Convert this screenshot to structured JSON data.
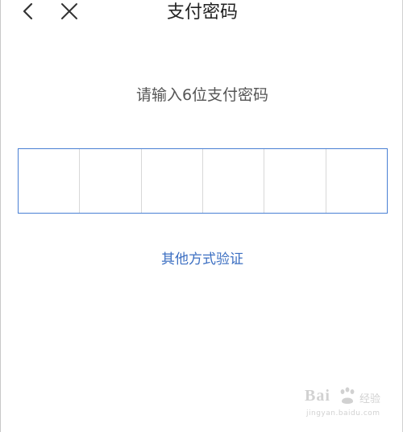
{
  "header": {
    "title": "支付密码",
    "back_icon": "chevron-left-icon",
    "close_icon": "close-icon"
  },
  "prompt": "请输入6位支付密码",
  "pin": {
    "length": 6,
    "border_color": "#4a80d4"
  },
  "alt_verify_label": "其他方式验证",
  "colors": {
    "accent": "#3c6fc2",
    "title": "#222222",
    "prompt": "#555555"
  },
  "watermark": {
    "logo": "Bai",
    "subtitle": "经验",
    "url": "jingyan.baidu.com"
  }
}
